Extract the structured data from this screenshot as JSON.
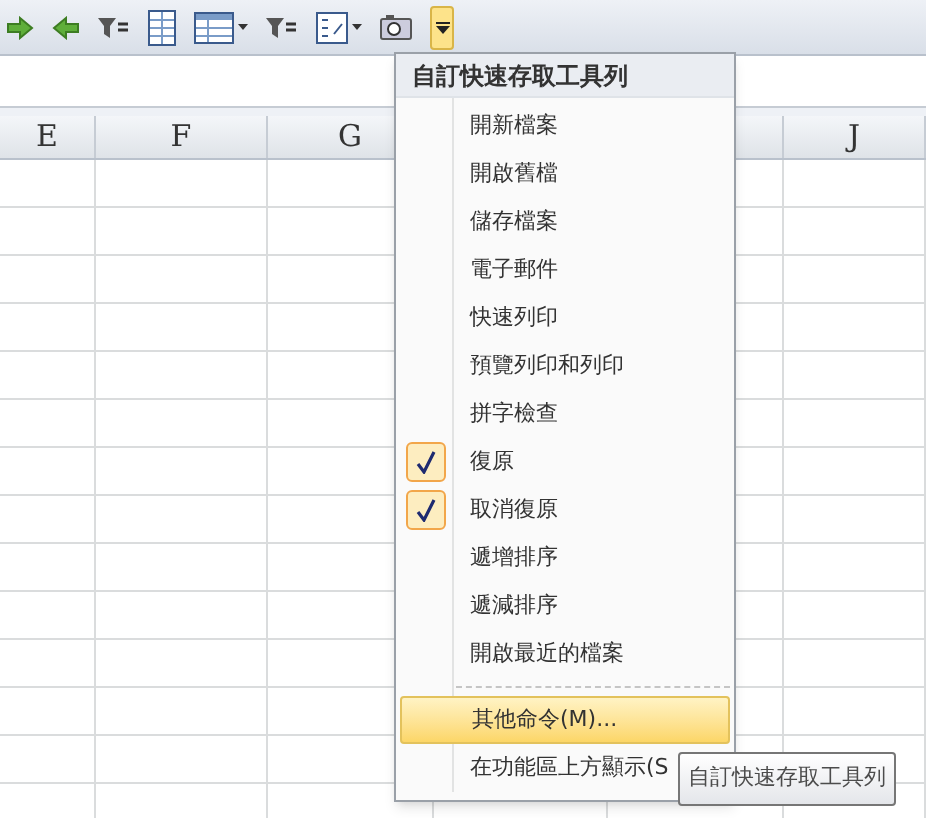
{
  "columns": [
    {
      "label": "E"
    },
    {
      "label": "F"
    },
    {
      "label": "G"
    },
    {
      "label": "J"
    }
  ],
  "menu": {
    "title": "自訂快速存取工具列",
    "items": [
      {
        "label": "開新檔案",
        "checked": false
      },
      {
        "label": "開啟舊檔",
        "checked": false
      },
      {
        "label": "儲存檔案",
        "checked": false
      },
      {
        "label": "電子郵件",
        "checked": false
      },
      {
        "label": "快速列印",
        "checked": false
      },
      {
        "label": "預覽列印和列印",
        "checked": false
      },
      {
        "label": "拼字檢查",
        "checked": false
      },
      {
        "label": "復原",
        "checked": true
      },
      {
        "label": "取消復原",
        "checked": true
      },
      {
        "label": "遞增排序",
        "checked": false
      },
      {
        "label": "遞減排序",
        "checked": false
      },
      {
        "label": "開啟最近的檔案",
        "checked": false
      }
    ],
    "more": {
      "label": "其他命令(M)...",
      "selected": true
    },
    "show_below": {
      "label": "在功能區上方顯示(S"
    }
  },
  "tooltip": "自訂快速存取工具列"
}
